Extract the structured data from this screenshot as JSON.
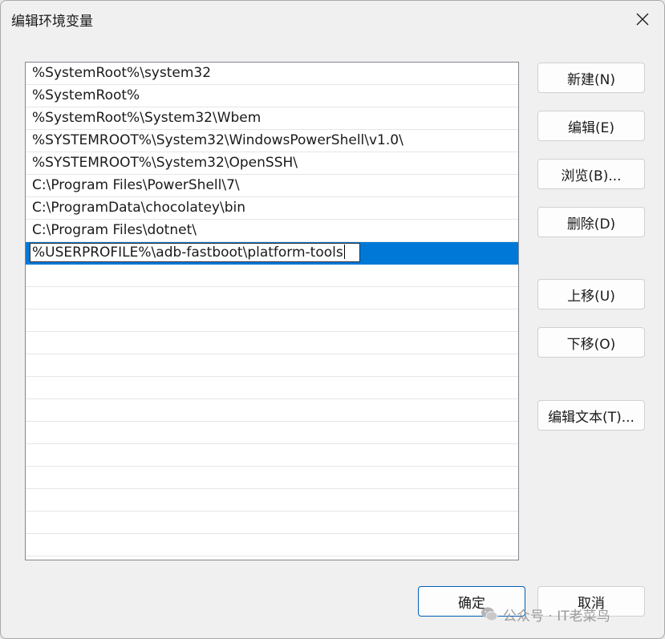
{
  "window": {
    "title": "编辑环境变量"
  },
  "list": {
    "items": [
      "%SystemRoot%\\system32",
      "%SystemRoot%",
      "%SystemRoot%\\System32\\Wbem",
      "%SYSTEMROOT%\\System32\\WindowsPowerShell\\v1.0\\",
      "%SYSTEMROOT%\\System32\\OpenSSH\\",
      "C:\\Program Files\\PowerShell\\7\\",
      "C:\\ProgramData\\chocolatey\\bin",
      "C:\\Program Files\\dotnet\\"
    ],
    "editing_value": "%USERPROFILE%\\adb-fastboot\\platform-tools",
    "selection_color": "#0078d7"
  },
  "buttons": {
    "new": "新建(N)",
    "edit": "编辑(E)",
    "browse": "浏览(B)...",
    "delete": "删除(D)",
    "move_up": "上移(U)",
    "move_down": "下移(O)",
    "edit_text": "编辑文本(T)...",
    "ok": "确定",
    "cancel": "取消"
  },
  "watermark": {
    "text": "公众号 · IT老菜鸟",
    "icon": "wechat-icon"
  }
}
